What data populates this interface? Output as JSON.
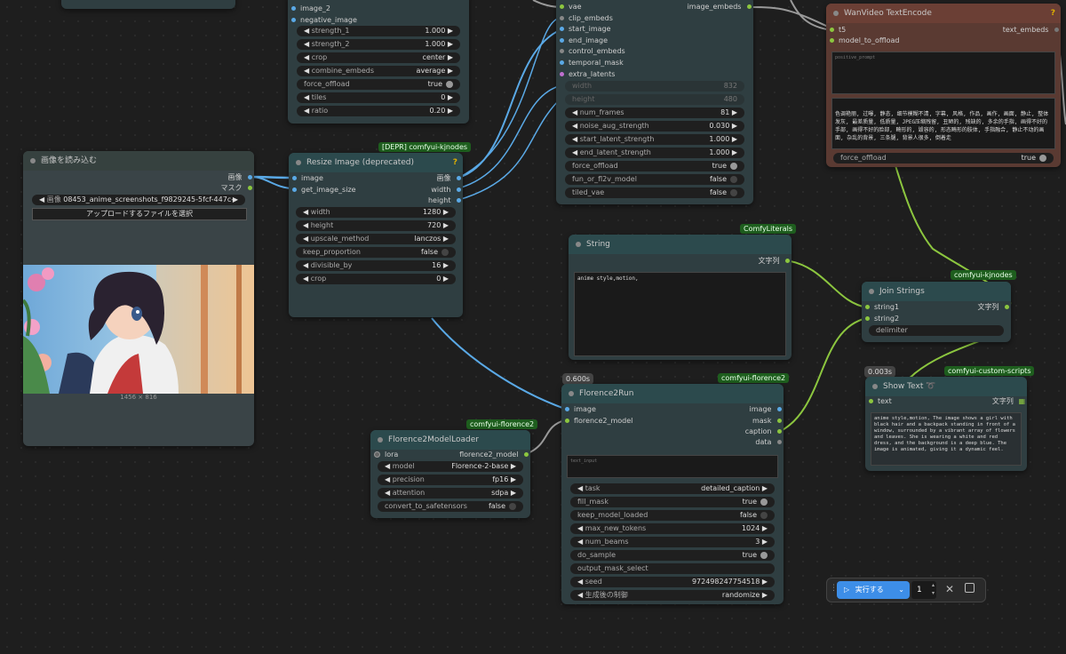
{
  "colors": {
    "wire_image": "#5aa9e6",
    "wire_string": "#8cc63f",
    "wire_gray": "#999999",
    "badge": "#1e5e1e"
  },
  "top_left_node": {
    "inputs": [
      "image_2",
      "negative_image"
    ],
    "widgets": [
      {
        "label": "strength_1",
        "value": "1.000"
      },
      {
        "label": "strength_2",
        "value": "1.000"
      },
      {
        "label": "crop",
        "value": "center"
      },
      {
        "label": "combine_embeds",
        "value": "average"
      },
      {
        "label": "force_offload",
        "value": "true"
      },
      {
        "label": "tiles",
        "value": "0"
      },
      {
        "label": "ratio",
        "value": "0.20"
      }
    ]
  },
  "image_embeds_node": {
    "inputs": [
      "vae",
      "clip_embeds",
      "start_image",
      "end_image",
      "control_embeds",
      "temporal_mask",
      "extra_latents"
    ],
    "output": "image_embeds",
    "dim_widgets": [
      {
        "label": "width",
        "value": "832"
      },
      {
        "label": "height",
        "value": "480"
      }
    ],
    "widgets": [
      {
        "label": "num_frames",
        "value": "81"
      },
      {
        "label": "noise_aug_strength",
        "value": "0.030"
      },
      {
        "label": "start_latent_strength",
        "value": "1.000"
      },
      {
        "label": "end_latent_strength",
        "value": "1.000"
      },
      {
        "label": "force_offload",
        "value": "true"
      },
      {
        "label": "fun_or_fl2v_model",
        "value": "false"
      },
      {
        "label": "tiled_vae",
        "value": "false"
      }
    ]
  },
  "text_encode": {
    "title": "WanVideo TextEncode",
    "inputs": [
      "t5",
      "model_to_offload"
    ],
    "output": "text_embeds",
    "positive_placeholder": "positive_prompt",
    "negative_text": "色调艳丽, 过曝, 静态, 细节模糊不清, 字幕, 风格, 作品, 画作, 画面, 静止, 整体发灰, 最差质量, 低质量, JPEG压缩残留, 丑陋的, 残缺的, 多余的手指, 画得不好的手部, 画得不好的脸部, 畸形的, 毁容的, 形态畸形的肢体, 手指融合, 静止不动的画面, 杂乱的背景, 三条腿, 背景人很多, 倒着走",
    "force_offload": "true"
  },
  "load_image": {
    "title": "画像を読み込む",
    "outputs": [
      "画像",
      "マスク"
    ],
    "file_label": "画像",
    "file_value": "08453_anime_screenshots_f9829245-5fcf-447c-bd7...",
    "upload_button": "アップロードするファイルを選択",
    "dimensions": "1456 × 816"
  },
  "resize_image": {
    "title": "Resize Image (deprecated)",
    "badge": "[DEPR] comfyui-kjnodes",
    "help": "?",
    "inputs": [
      "image",
      "get_image_size"
    ],
    "outputs": [
      "画像",
      "width",
      "height"
    ],
    "widgets": [
      {
        "label": "width",
        "value": "1280"
      },
      {
        "label": "height",
        "value": "720"
      },
      {
        "label": "upscale_method",
        "value": "lanczos"
      },
      {
        "label": "keep_proportion",
        "value": "false"
      },
      {
        "label": "divisible_by",
        "value": "16"
      },
      {
        "label": "crop",
        "value": "0"
      }
    ]
  },
  "string_node": {
    "title": "String",
    "badge": "ComfyLiterals",
    "output": "文字列",
    "text": "anime style,motion,"
  },
  "join_strings": {
    "title": "Join Strings",
    "badge": "comfyui-kjnodes",
    "inputs": [
      "string1",
      "string2"
    ],
    "output": "文字列",
    "widget": "delimiter"
  },
  "show_text": {
    "title": "Show Text",
    "badge": "comfyui-custom-scripts",
    "timer": "0.003s",
    "input": "text",
    "output": "文字列",
    "text": "anime style,motion, The image shows a girl with black hair and a backpack standing in front of a window, surrounded by a vibrant array of flowers and leaves. She is wearing a white and red dress, and the background is a deep blue. The image is animated, giving it a dynamic feel."
  },
  "florence_loader": {
    "title": "Florence2ModelLoader",
    "badge": "comfyui-florence2",
    "input": "lora",
    "output": "florence2_model",
    "widgets": [
      {
        "label": "model",
        "value": "Florence-2-base"
      },
      {
        "label": "precision",
        "value": "fp16"
      },
      {
        "label": "attention",
        "value": "sdpa"
      },
      {
        "label": "convert_to_safetensors",
        "value": "false"
      }
    ]
  },
  "florence_run": {
    "title": "Florence2Run",
    "badge": "comfyui-florence2",
    "timer": "0.600s",
    "inputs": [
      "image",
      "florence2_model"
    ],
    "outputs": [
      "image",
      "mask",
      "caption",
      "data"
    ],
    "text_placeholder": "text_input",
    "widgets": [
      {
        "label": "task",
        "value": "detailed_caption"
      },
      {
        "label": "fill_mask",
        "value": "true"
      },
      {
        "label": "keep_model_loaded",
        "value": "false"
      },
      {
        "label": "max_new_tokens",
        "value": "1024"
      },
      {
        "label": "num_beams",
        "value": "3"
      },
      {
        "label": "do_sample",
        "value": "true"
      },
      {
        "label": "output_mask_select",
        "value": ""
      },
      {
        "label": "seed",
        "value": "972498247754518"
      },
      {
        "label": "生成後の制御",
        "value": "randomize"
      }
    ]
  },
  "run_bar": {
    "run_label": "実行する",
    "count": "1"
  }
}
